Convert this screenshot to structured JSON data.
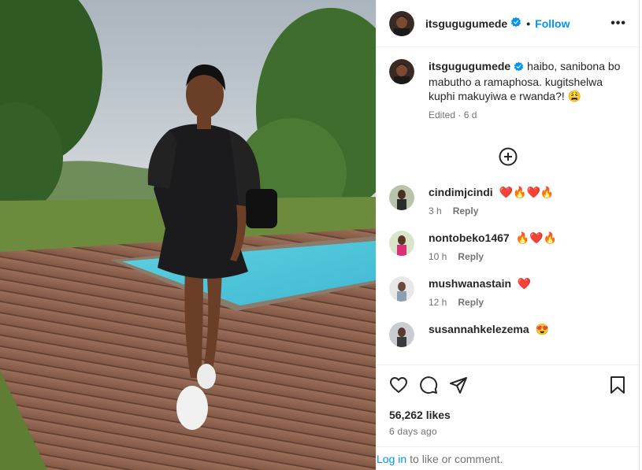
{
  "post": {
    "username": "itsgugugumede",
    "follow_label": "Follow",
    "more_label": "•••",
    "caption_text": "haibo, sanibona bo mabutho a ramaphosa. kugitshelwa kuphi makuyiwa e rwanda?! 😩",
    "caption_meta": "Edited · 6 d"
  },
  "comments": [
    {
      "username": "cindimjcindi",
      "text": "❤️🔥❤️🔥",
      "time": "3 h",
      "reply": "Reply"
    },
    {
      "username": "nontobeko1467",
      "text": "🔥❤️🔥",
      "time": "10 h",
      "reply": "Reply"
    },
    {
      "username": "mushwanastain",
      "text": "❤️",
      "time": "12 h",
      "reply": "Reply"
    },
    {
      "username": "susannahkelezema",
      "text": "😍",
      "time": "",
      "reply": ""
    }
  ],
  "footer": {
    "likes": "56,262 likes",
    "ago": "6 days ago",
    "login_link": "Log in",
    "login_rest": "to like or comment."
  },
  "icons": {
    "verified": "verified-badge-icon",
    "like": "heart-icon",
    "comment": "comment-icon",
    "share": "paper-plane-icon",
    "save": "bookmark-icon",
    "load_more": "plus-circle-icon"
  },
  "colors": {
    "accent": "#0095f6",
    "text": "#262626",
    "muted": "#737373",
    "verified": "#0095f6"
  }
}
